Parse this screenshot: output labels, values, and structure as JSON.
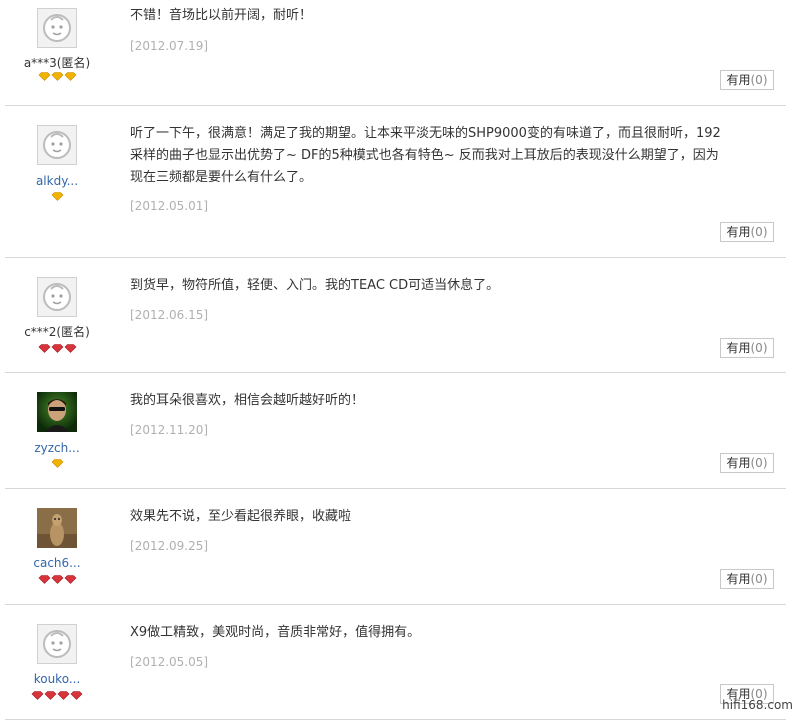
{
  "reviews": [
    {
      "username": "a***3(匿名)",
      "avatar": "default-baby-avatar",
      "badge_type": "gold",
      "badge_count": 3,
      "text": "不错！音场比以前开阔，耐听！",
      "date": "[2012.07.19]",
      "useful_label": "有用",
      "useful_count": "(0)"
    },
    {
      "username": "alkdy...",
      "avatar": "default-baby-avatar",
      "badge_type": "gold",
      "badge_count": 1,
      "text": "听了一下午，很满意！满足了我的期望。让本来平淡无味的SHP9000变的有味道了，而且很耐听，192采样的曲子也显示出优势了~ DF的5种模式也各有特色~ 反而我对上耳放后的表现没什么期望了，因为现在三频都是要什么有什么了。",
      "date": "[2012.05.01]",
      "useful_label": "有用",
      "useful_count": "(0)"
    },
    {
      "username": "c***2(匿名)",
      "avatar": "default-baby-avatar",
      "badge_type": "red",
      "badge_count": 3,
      "text": "到货早，物符所值，轻便、入门。我的TEAC CD可适当休息了。",
      "date": "[2012.06.15]",
      "useful_label": "有用",
      "useful_count": "(0)"
    },
    {
      "username": "zyzch...",
      "avatar": "photo-man-green",
      "badge_type": "gold",
      "badge_count": 1,
      "text": "我的耳朵很喜欢，相信会越听越好听的！",
      "date": "[2012.11.20]",
      "useful_label": "有用",
      "useful_count": "(0)"
    },
    {
      "username": "cach6...",
      "avatar": "photo-meerkat",
      "badge_type": "red",
      "badge_count": 3,
      "text": "效果先不说，至少看起很养眼，收藏啦",
      "date": "[2012.09.25]",
      "useful_label": "有用",
      "useful_count": "(0)"
    },
    {
      "username": "kouko...",
      "avatar": "default-baby-avatar",
      "badge_type": "red",
      "badge_count": 4,
      "text": "X9做工精致，美观时尚，音质非常好，值得拥有。",
      "date": "[2012.05.05]",
      "useful_label": "有用",
      "useful_count": "(0)"
    }
  ],
  "watermark": "hifi168.com",
  "colors": {
    "gold_badge": "#f0b400",
    "red_badge": "#d8343c",
    "username_link": "#3366aa",
    "date": "#b0b0b0"
  }
}
